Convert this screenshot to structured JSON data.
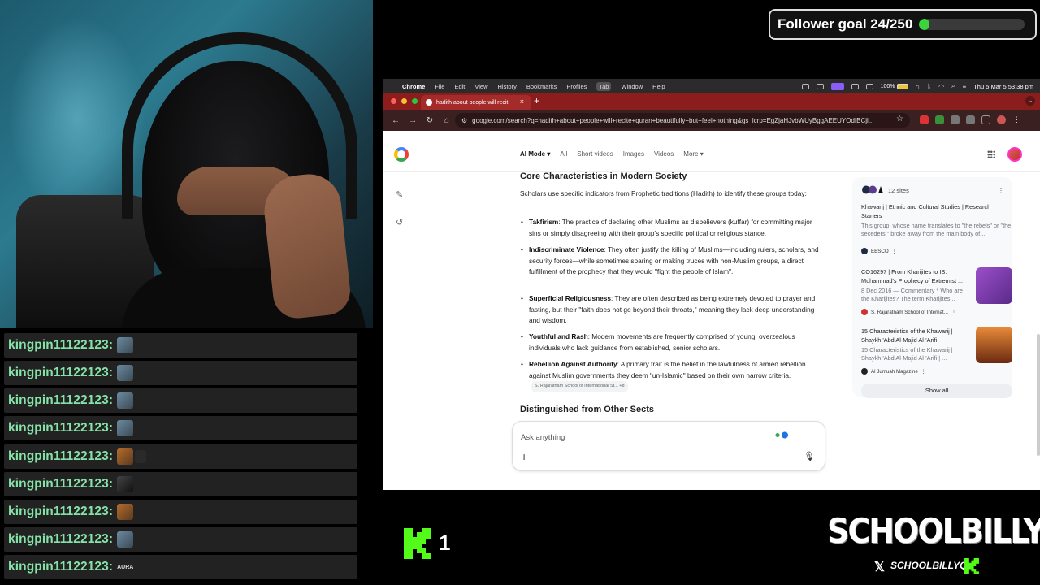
{
  "overlay": {
    "follower_goal_label": "Follower goal 24/250",
    "follower_goal_progress": 0.096,
    "viewer_count": "1",
    "brand_name": "SCHOOLBILLYQ",
    "brand_x_handle": "SCHOOLBILLYQ"
  },
  "chat": {
    "messages": [
      {
        "user": "kingpin11122123:",
        "emote": "emote"
      },
      {
        "user": "kingpin11122123:",
        "emote": "emote"
      },
      {
        "user": "kingpin11122123:",
        "emote": "emote"
      },
      {
        "user": "kingpin11122123:",
        "emote": "emote"
      },
      {
        "user": "kingpin11122123:",
        "emote": "emote"
      },
      {
        "user": "kingpin11122123:",
        "emote": "emote"
      },
      {
        "user": "kingpin11122123:",
        "emote": "emote"
      },
      {
        "user": "kingpin11122123:",
        "emote": "emote"
      },
      {
        "user": "kingpin11122123:",
        "emote_text": "AURA"
      }
    ]
  },
  "mac_menubar": {
    "items": [
      "Chrome",
      "File",
      "Edit",
      "View",
      "History",
      "Bookmarks",
      "Profiles",
      "Tab",
      "Window",
      "Help"
    ],
    "battery": "100%",
    "clock": "Thu 5 Mar  5:53:38 pm"
  },
  "browser": {
    "tab_title": "hadith about people will recit",
    "url": "google.com/search?q=hadith+about+people+will+recite+quran+beautifully+but+feel+nothing&gs_lcrp=EgZjaHJvbWUyBggAEEUYOdIBCjl..."
  },
  "google": {
    "tabs": [
      "AI Mode",
      "All",
      "Short videos",
      "Images",
      "Videos",
      "More"
    ],
    "heading_core": "Core Characteristics in Modern Society",
    "intro": "Scholars use specific indicators from Prophetic traditions (Hadith) to identify these groups today:",
    "bullets": [
      {
        "term": "Takfirism",
        "text": ": The practice of declaring other Muslims as disbelievers (kuffar) for committing major sins or simply disagreeing with their group's specific political or religious stance."
      },
      {
        "term": "Indiscriminate Violence",
        "text": ": They often justify the killing of Muslims—including rulers, scholars, and security forces—while sometimes sparing or making truces with non-Muslim groups, a direct fulfillment of the prophecy that they would \"fight the people of Islam\"."
      },
      {
        "term": "Superficial Religiousness",
        "text": ": They are often described as being extremely devoted to prayer and fasting, but their \"faith does not go beyond their throats,\" meaning they lack deep understanding and wisdom."
      },
      {
        "term": "Youthful and Rash",
        "text": ": Modern movements are frequently comprised of young, overzealous individuals who lack guidance from established, senior scholars."
      },
      {
        "term": "Rebellion Against Authority",
        "text": ": A primary trait is the belief in the lawfulness of armed rebellion against Muslim governments they deem \"un-Islamic\" based on their own narrow criteria."
      }
    ],
    "citation": "S. Rajaratnam School of International St...  +8",
    "heading_dist": "Distinguished from Other Sects",
    "ask_placeholder": "Ask anything",
    "side_panel": {
      "sites_label": "12 sites",
      "items": [
        {
          "title": "Khawarij | Ethnic and Cultural Studies | Research Starters",
          "snippet": "This group, whose name translates to \"the rebels\" or \"the seceders,\" broke away from the main body of...",
          "source": "EBSCO"
        },
        {
          "title": "CO16297 | From Kharijites to IS: Muhammad's Prophecy of Extremist ...",
          "snippet": "8 Dec 2016 — Commentary * Who are the Kharijites? The term Kharijites...",
          "source": "S. Rajaratnam School of Internat..."
        },
        {
          "title": "15 Characteristics of the Khawarij | Shaykh 'Abd Al-Majid Al-'Arifi",
          "snippet": "15 Characteristics of the Khawarij | Shaykh 'Abd Al-Majid Al-'Arifi | ...",
          "source": "Al Jumuah Magazine"
        }
      ],
      "show_all": "Show all"
    }
  },
  "colors": {
    "chat_user": "#86e3a8",
    "goal_fill": "#3bd43b",
    "kick_green": "#53fc18",
    "tab_bar": "#8b1d1d"
  }
}
